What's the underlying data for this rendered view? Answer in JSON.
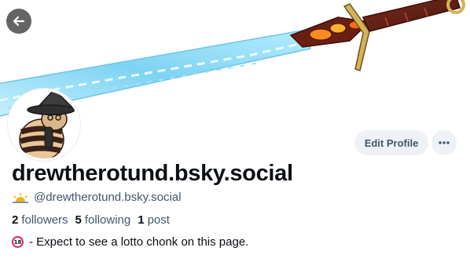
{
  "banner": {
    "image_icon": "sword-banner-image"
  },
  "nav": {
    "back_icon": "arrow-left-icon"
  },
  "profile": {
    "display_name": "drewtherotund.bsky.social",
    "handle": "@drewtherotund.bsky.social",
    "handle_badge_icon": "sunrise-icon",
    "avatar_icon": "wizard-hat-avatar"
  },
  "actions": {
    "edit_profile_label": "Edit Profile",
    "more_icon": "ellipsis-icon"
  },
  "stats": {
    "followers_count": "2",
    "followers_label": "followers",
    "following_count": "5",
    "following_label": "following",
    "posts_count": "1",
    "posts_label": "post"
  },
  "bio": {
    "icon_text": "18",
    "icon": "no-under-18-icon",
    "text": " - Expect to see a lotto chonk on this page."
  },
  "colors": {
    "button_bg": "#eef2f6",
    "secondary_text": "#42566f",
    "primary_text": "#0b0f14",
    "blade_blue": "#8fd8f5"
  }
}
